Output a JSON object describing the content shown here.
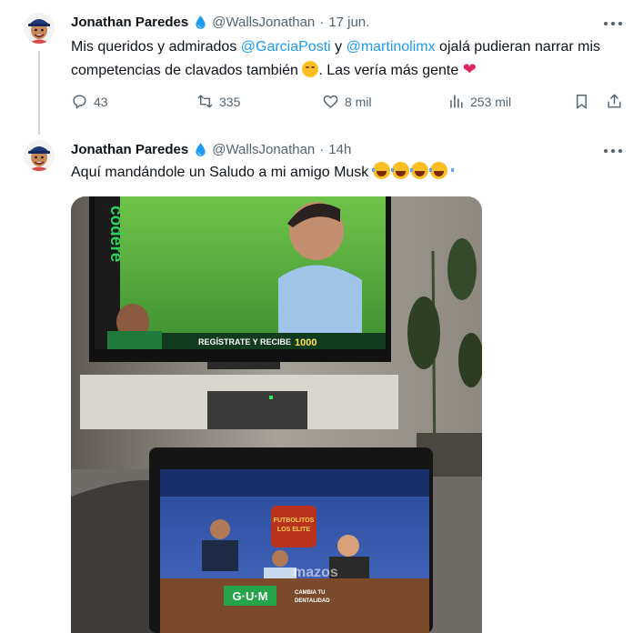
{
  "tweets": [
    {
      "author": {
        "name": "Jonathan Paredes",
        "handle": "@WallsJonathan"
      },
      "separator": "·",
      "time": "17 jun.",
      "text": {
        "part1": "Mis queridos y admirados ",
        "mention1": "@GarciaPosti",
        "part2": " y ",
        "mention2": "@martinolimx",
        "part3": " ojalá pudieran narrar mis competencias de clavados también ",
        "part4": ". Las vería más gente "
      },
      "stats": {
        "replies": "43",
        "retweets": "335",
        "likes": "8 mil",
        "views": "253 mil"
      }
    },
    {
      "author": {
        "name": "Jonathan Paredes",
        "handle": "@WallsJonathan"
      },
      "separator": "·",
      "time": "14h",
      "text": {
        "part1": "Aquí mandándole un Saludo a mi amigo Musk "
      },
      "media": {
        "tv_brand": "codere",
        "tv_banner": "REGÍSTRATE Y RECIBE",
        "tv_banner_amount": "1000",
        "laptop_show_line1": "FUTBOLITOS",
        "laptop_show_line2": "LOS ELITE",
        "sponsor": "G·U·M",
        "sponsor_tag1": "CAMBIA TU",
        "sponsor_tag2": "DENTALIDAD",
        "laptop_watermark": "mazos"
      }
    }
  ],
  "colors": {
    "accent": "#1d9bf0",
    "verified": "#1d9bf0",
    "muted": "#536471",
    "heart": "#e0245e"
  },
  "icons": [
    "verified-badge-icon",
    "more-icon",
    "reply-icon",
    "retweet-icon",
    "like-icon",
    "views-icon",
    "bookmark-icon",
    "share-icon",
    "relieved-face-emoji",
    "red-heart-emoji",
    "laughing-tears-emoji"
  ]
}
